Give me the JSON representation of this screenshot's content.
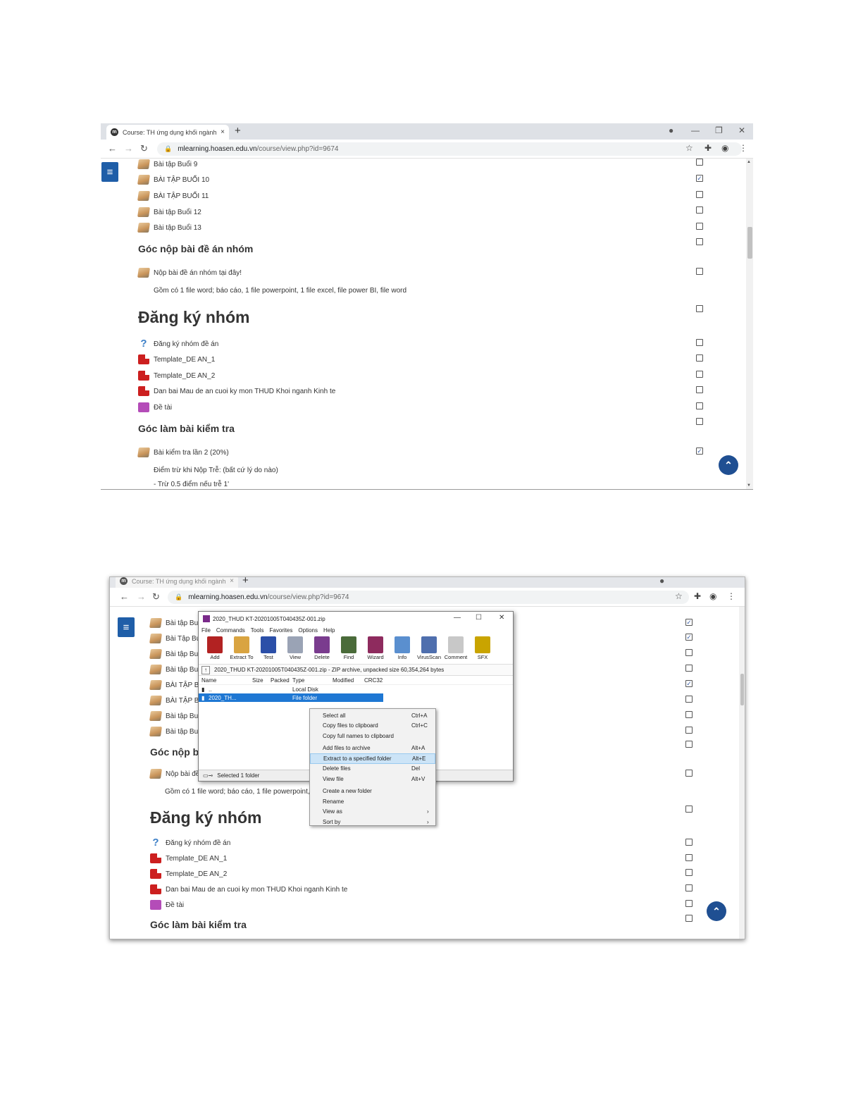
{
  "browser": {
    "tab_title": "Course: TH ứng dụng khối ngành",
    "tab_close": "×",
    "new_tab": "+",
    "url_host": "mlearning.hoasen.edu.vn",
    "url_path": "/course/view.php?id=9674"
  },
  "shot1": {
    "items_top": [
      {
        "label": "Bài tập Buổi 9",
        "checked": false
      },
      {
        "label": "BÀI TẬP BUỔI 10",
        "checked": true
      },
      {
        "label": "BÀI TẬP BUỔI 11",
        "checked": false
      },
      {
        "label": "Bài tập Buổi 12",
        "checked": false
      },
      {
        "label": "Bài tập Buổi 13",
        "checked": false
      }
    ],
    "section1_title": "Góc nộp bài đề án nhóm",
    "submit_item": "Nộp bài đề án nhóm tại đây!",
    "submit_desc": "Gồm có 1 file word; báo cáo, 1 file powerpoint, 1 file excel, file  power BI, file word",
    "section2_title": "Đăng ký nhóm",
    "group_items": [
      {
        "label": "Đăng ký nhóm đề án",
        "icon": "quiz"
      },
      {
        "label": "Template_DE AN_1",
        "icon": "pdf"
      },
      {
        "label": "Template_DE AN_2",
        "icon": "pdf"
      },
      {
        "label": "Dan bai Mau de an cuoi ky mon THUD Khoi nganh Kinh te",
        "icon": "pdf"
      },
      {
        "label": "Đề tài",
        "icon": "page"
      }
    ],
    "section3_title": "Góc làm bài kiểm tra",
    "test_item": "Bài kiểm tra lần 2 (20%)",
    "test_desc1": "Điểm trừ khi Nộp Trễ: (bất cứ lý do nào)",
    "test_desc2": "- Trừ 0.5 điểm nếu trễ 1'"
  },
  "shot2": {
    "items_cut": [
      "Bài tập Buổ",
      "Bài Tập Bu",
      "Bài tập Buổ",
      "Bài tập Buổ",
      "BÀI TẬP BU",
      "BÀI TẬP BU",
      "Bài tập Buổ",
      "Bài tập Buổ"
    ],
    "section1_cut": "Góc nộp b",
    "submit_cut": "Nộp bài đề",
    "submit_desc_cut": "Gồm có 1 file word; báo cáo, 1 file powerpoint, 1",
    "section2_title": "Đăng ký nhóm",
    "group_items": [
      "Đăng ký nhóm đề án",
      "Template_DE AN_1",
      "Template_DE AN_2",
      "Dan bai Mau de an cuoi ky mon THUD Khoi nganh Kinh te",
      "Đề tài"
    ],
    "section3_title": "Góc làm bài kiểm tra"
  },
  "winrar": {
    "title": "2020_THUD KT-20201005T040435Z-001.zip",
    "menu": [
      "File",
      "Commands",
      "Tools",
      "Favorites",
      "Options",
      "Help"
    ],
    "tools": [
      {
        "label": "Add",
        "color": "#b22222"
      },
      {
        "label": "Extract To",
        "color": "#d9a441"
      },
      {
        "label": "Test",
        "color": "#2b4fa8"
      },
      {
        "label": "View",
        "color": "#9aa3b5"
      },
      {
        "label": "Delete",
        "color": "#7a3c8e"
      },
      {
        "label": "Find",
        "color": "#4a6b3a"
      },
      {
        "label": "Wizard",
        "color": "#8e2b5e"
      },
      {
        "label": "Info",
        "color": "#5a8fcf"
      },
      {
        "label": "VirusScan",
        "color": "#4f6fae"
      },
      {
        "label": "Comment",
        "color": "#c8c8c8"
      },
      {
        "label": "SFX",
        "color": "#c9a400"
      }
    ],
    "path_text": "2020_THUD KT-20201005T040435Z-001.zip - ZIP archive, unpacked size 60,354,264 bytes",
    "columns": [
      "Name",
      "Size",
      "Packed",
      "Type",
      "Modified",
      "CRC32"
    ],
    "rows": [
      {
        "name": "..",
        "type": "Local Disk"
      },
      {
        "name": "2020_TH...",
        "type": "File folder"
      }
    ],
    "status": "Selected 1 folder"
  },
  "context_menu": [
    {
      "label": "Select all",
      "shortcut": "Ctrl+A"
    },
    {
      "label": "Copy files to clipboard",
      "shortcut": "Ctrl+C"
    },
    {
      "label": "Copy full names to clipboard",
      "shortcut": ""
    },
    {
      "label": "Add files to archive",
      "shortcut": "Alt+A"
    },
    {
      "label": "Extract to a specified folder",
      "shortcut": "Alt+E"
    },
    {
      "label": "Delete files",
      "shortcut": "Del"
    },
    {
      "label": "View file",
      "shortcut": "Alt+V"
    },
    {
      "label": "Create a new folder",
      "shortcut": ""
    },
    {
      "label": "Rename",
      "shortcut": ""
    },
    {
      "label": "View as",
      "shortcut": "›"
    },
    {
      "label": "Sort by",
      "shortcut": "›"
    }
  ]
}
